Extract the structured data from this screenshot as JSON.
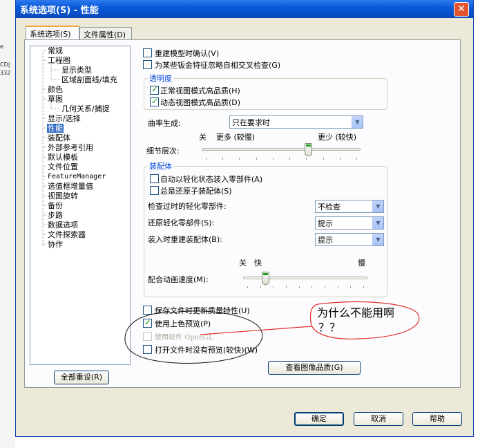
{
  "background_fragments": [
    "e",
    "CD|",
    "332"
  ],
  "window": {
    "title": "系统选项(S) - 性能",
    "close_glyph": "✕"
  },
  "tabs": [
    {
      "label": "系统选项(S)",
      "active": true
    },
    {
      "label": "文件属性(D)",
      "active": false
    }
  ],
  "tree": {
    "items": [
      {
        "label": "常规"
      },
      {
        "label": "工程图"
      },
      {
        "label": "显示类型"
      },
      {
        "label": "区域剖面线/填充"
      },
      {
        "label": "颜色"
      },
      {
        "label": "草图"
      },
      {
        "label": "几何关系/捕捉"
      },
      {
        "label": "显示/选择"
      },
      {
        "label": "性能",
        "selected": true
      },
      {
        "label": "装配体"
      },
      {
        "label": "外部参考引用"
      },
      {
        "label": "默认模板"
      },
      {
        "label": "文件位置"
      },
      {
        "label": "FeatureManager"
      },
      {
        "label": "选值框增量值"
      },
      {
        "label": "视图旋转"
      },
      {
        "label": "备份"
      },
      {
        "label": "步路"
      },
      {
        "label": "数据选项"
      },
      {
        "label": "文件探索器"
      },
      {
        "label": "协作"
      }
    ]
  },
  "reset_all_label": "全部重设(R)",
  "options_top": [
    {
      "label": "重建模型时确认(V)",
      "checked": false
    },
    {
      "label": "为某些钣金特征忽略自相交叉检查(G)",
      "checked": false
    }
  ],
  "transparency": {
    "title": "透明度",
    "options": [
      {
        "label": "正常视图模式高品质(H)",
        "checked": true
      },
      {
        "label": "动态视图模式高品质(D)",
        "checked": true
      }
    ]
  },
  "curvature": {
    "label": "曲率生成:",
    "value": "只在要求时"
  },
  "detail": {
    "left_label": "关",
    "more_label": "更多 (较慢)",
    "less_label": "更少 (较快)",
    "label": "细节层次:",
    "level": 0.67
  },
  "assembly": {
    "title": "装配体",
    "options": [
      {
        "label": "自动以轻化状态装入零部件(A)",
        "checked": false
      },
      {
        "label": "总是还原子装配体(S)",
        "checked": false
      }
    ],
    "rows": [
      {
        "label": "检查过时的轻化零部件:",
        "value": "不检查"
      },
      {
        "label": "还原轻化零部件(S):",
        "value": "提示"
      },
      {
        "label": "装入时重建装配体(B):",
        "value": "提示"
      }
    ],
    "anim": {
      "off_label": "关",
      "fast_label": "快",
      "slow_label": "慢",
      "label": "配合动画速度(M):",
      "level": 0.18
    }
  },
  "options_bottom": [
    {
      "label": "保存文件时更新质量特性(U)",
      "checked": false,
      "disabled": false
    },
    {
      "label": "使用上色预览(P)",
      "checked": true,
      "disabled": false
    },
    {
      "label": "使用软件 OpenGL",
      "checked": false,
      "disabled": true
    },
    {
      "label": "打开文件时没有预览(较快)(W)",
      "checked": false,
      "disabled": false
    }
  ],
  "view_quality_label": "查看图像品质(G)",
  "buttons": {
    "ok": "确定",
    "cancel": "取消",
    "help": "帮助"
  },
  "annotation": {
    "line1": "为什么不能用啊",
    "line2": "？？"
  },
  "colors": {
    "titlebar": "#0b5ad8",
    "selection": "#316ac5",
    "group_title": "#0046d5",
    "annotation": "#e0302a",
    "check": "#21a121"
  }
}
